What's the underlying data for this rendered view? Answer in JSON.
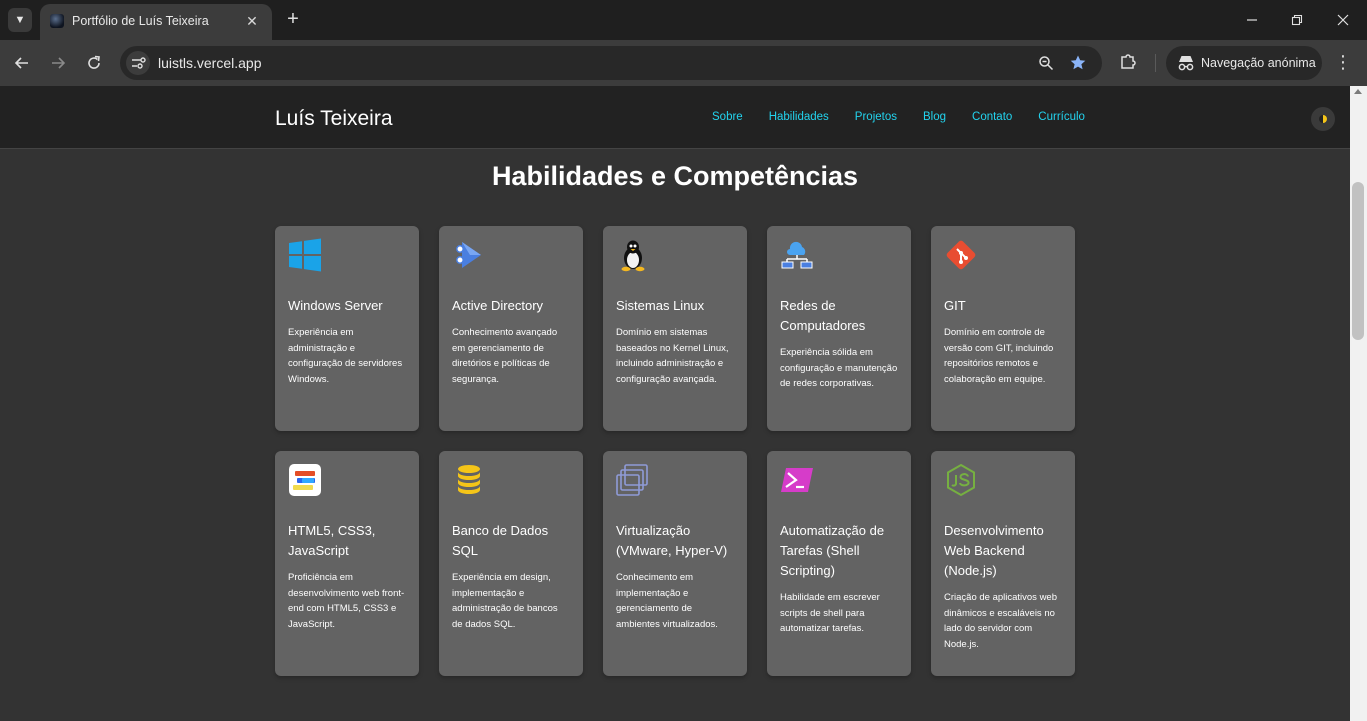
{
  "browser": {
    "tab_title": "Portfólio de Luís Teixeira",
    "url": "luistls.vercel.app",
    "incognito_label": "Navegação anónima"
  },
  "site": {
    "brand": "Luís Teixeira",
    "nav": [
      "Sobre",
      "Habilidades",
      "Projetos",
      "Blog",
      "Contato",
      "Currículo"
    ],
    "section_title": "Habilidades e Competências"
  },
  "skills": [
    {
      "icon": "windows-icon",
      "title": "Windows Server",
      "desc": "Experiência em administração e configuração de servidores Windows."
    },
    {
      "icon": "active-directory-icon",
      "title": "Active Directory",
      "desc": "Conhecimento avançado em gerenciamento de diretórios e políticas de segurança."
    },
    {
      "icon": "linux-tux-icon",
      "title": "Sistemas Linux",
      "desc": "Domínio em sistemas baseados no Kernel Linux, incluindo administração e configuração avançada."
    },
    {
      "icon": "network-icon",
      "title": "Redes de Computadores",
      "desc": "Experiência sólida em configuração e manutenção de redes corporativas."
    },
    {
      "icon": "git-icon",
      "title": "GIT",
      "desc": "Domínio em controle de versão com GIT, incluindo repositórios remotos e colaboração em equipe."
    },
    {
      "icon": "html-css-js-icon",
      "title": "HTML5, CSS3, JavaScript",
      "desc": "Proficiência em desenvolvimento web front-end com HTML5, CSS3 e JavaScript."
    },
    {
      "icon": "database-icon",
      "title": "Banco de Dados SQL",
      "desc": "Experiência em design, implementação e administração de bancos de dados SQL."
    },
    {
      "icon": "virtualization-icon",
      "title": "Virtualização (VMware, Hyper-V)",
      "desc": "Conhecimento em implementação e gerenciamento de ambientes virtualizados."
    },
    {
      "icon": "powershell-icon",
      "title": "Automatização de Tarefas (Shell Scripting)",
      "desc": "Habilidade em escrever scripts de shell para automatizar tarefas."
    },
    {
      "icon": "nodejs-icon",
      "title": "Desenvolvimento Web Backend (Node.js)",
      "desc": "Criação de aplicativos web dinâmicos e escaláveis no lado do servidor com Node.js."
    }
  ]
}
